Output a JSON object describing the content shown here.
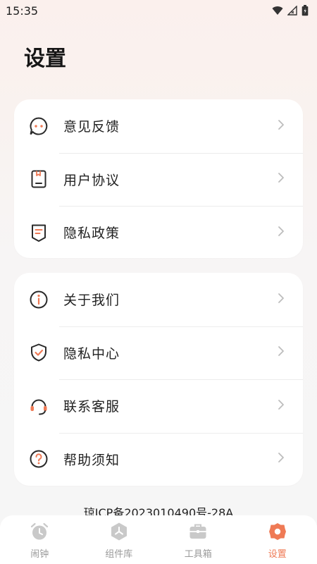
{
  "status_bar": {
    "time": "15:35"
  },
  "page": {
    "title": "设置"
  },
  "group1": [
    {
      "label": "意见反馈",
      "icon": "feedback-bubble-icon"
    },
    {
      "label": "用户协议",
      "icon": "agreement-icon"
    },
    {
      "label": "隐私政策",
      "icon": "policy-document-icon"
    }
  ],
  "group2": [
    {
      "label": "关于我们",
      "icon": "info-icon"
    },
    {
      "label": "隐私中心",
      "icon": "shield-check-icon"
    },
    {
      "label": "联系客服",
      "icon": "headset-icon"
    },
    {
      "label": "帮助须知",
      "icon": "help-icon"
    }
  ],
  "footer": {
    "icp": "琼ICP备2023010490号-28A"
  },
  "tabbar": {
    "tabs": [
      {
        "label": "闹钟",
        "icon": "alarm-clock-icon",
        "active": false
      },
      {
        "label": "组件库",
        "icon": "widget-library-icon",
        "active": false
      },
      {
        "label": "工具箱",
        "icon": "toolbox-icon",
        "active": false
      },
      {
        "label": "设置",
        "icon": "settings-gear-icon",
        "active": true
      }
    ]
  },
  "colors": {
    "accent": "#ef7a55",
    "icon_dark": "#2a2a2a",
    "inactive": "#9a9a9a"
  }
}
